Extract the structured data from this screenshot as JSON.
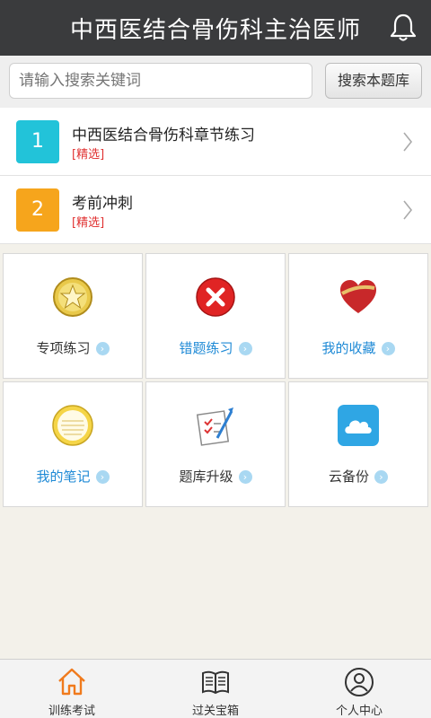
{
  "header": {
    "title": "中西医结合骨伤科主治医师",
    "icon": "bell-icon"
  },
  "search": {
    "placeholder": "请输入搜索关键词",
    "button_label": "搜索本题库"
  },
  "list": [
    {
      "number": "1",
      "title": "中西医结合骨伤科章节练习",
      "tag": "[精选]",
      "color": "#22c3d9"
    },
    {
      "number": "2",
      "title": "考前冲刺",
      "tag": "[精选]",
      "color": "#f6a51c"
    }
  ],
  "grid": [
    {
      "label": "专项练习",
      "icon": "star-icon"
    },
    {
      "label": "错题练习",
      "icon": "error-icon"
    },
    {
      "label": "我的收藏",
      "icon": "heart-icon"
    },
    {
      "label": "我的笔记",
      "icon": "notepad-icon"
    },
    {
      "label": "题库升级",
      "icon": "checklist-icon"
    },
    {
      "label": "云备份",
      "icon": "cloud-icon"
    }
  ],
  "tabbar": [
    {
      "label": "训练考试",
      "icon": "home-icon",
      "active": true
    },
    {
      "label": "过关宝箱",
      "icon": "book-icon"
    },
    {
      "label": "个人中心",
      "icon": "user-icon"
    }
  ],
  "colors": {
    "header_bg": "#3a3b3d",
    "link_blue": "#1f8ad6",
    "tag_red": "#e03030",
    "active_orange": "#f07a1c"
  }
}
